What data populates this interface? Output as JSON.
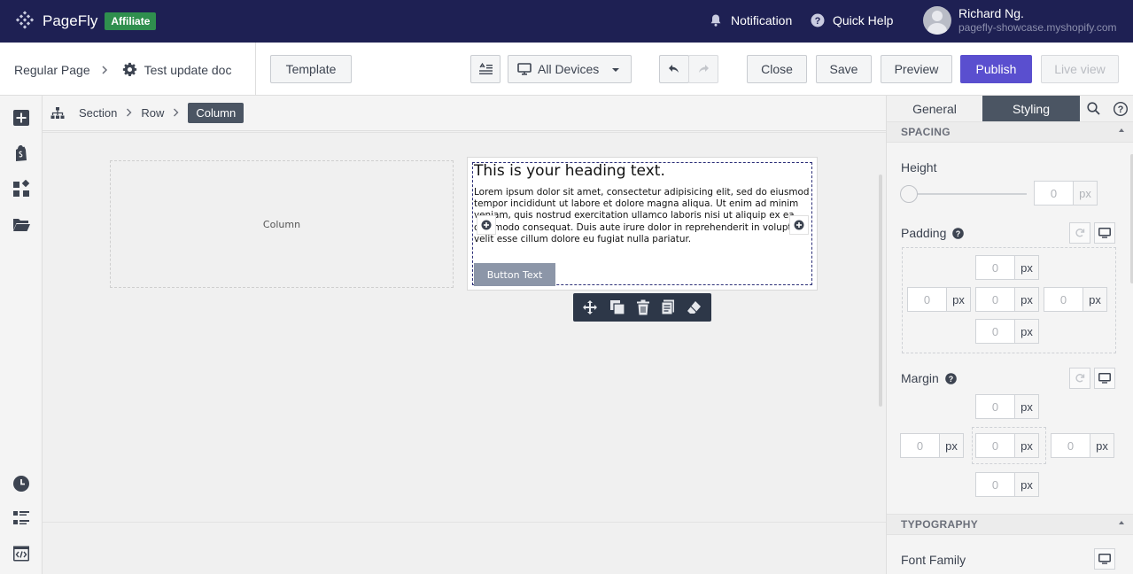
{
  "app": {
    "logo_name": "PageFly",
    "badge": "Affiliate",
    "notification_label": "Notification",
    "quick_help_label": "Quick Help",
    "user_name": "Richard Ng.",
    "user_shop": "pagefly-showcase.myshopify.com"
  },
  "toolbar": {
    "page_type": "Regular Page",
    "page_name": "Test update doc",
    "template_label": "Template",
    "device_label": "All Devices",
    "close_label": "Close",
    "save_label": "Save",
    "preview_label": "Preview",
    "publish_label": "Publish",
    "live_view_label": "Live view"
  },
  "breadcrumb": {
    "items": [
      "Section",
      "Row",
      "Column"
    ]
  },
  "canvas": {
    "column_placeholder": "Column",
    "heading": "This is your heading text.",
    "paragraph": "Lorem ipsum dolor sit amet, consectetur adipisicing elit, sed do eiusmod tempor incididunt ut labore et dolore magna aliqua. Ut enim ad minim veniam, quis nostrud exercitation ullamco laboris nisi ut aliquip ex ea commodo consequat. Duis aute irure dolor in reprehenderit in voluptate velit esse cillum dolore eu fugiat nulla pariatur.",
    "button_text": "Button Text"
  },
  "panel": {
    "tab_general": "General",
    "tab_styling": "Styling",
    "spacing_title": "SPACING",
    "height_label": "Height",
    "height_value": "0",
    "unit": "px",
    "padding_label": "Padding",
    "padding": {
      "top": "0",
      "left": "0",
      "center": "0",
      "right": "0",
      "bottom": "0"
    },
    "margin_label": "Margin",
    "margin": {
      "top": "0",
      "left": "0",
      "center": "0",
      "right": "0",
      "bottom": "0"
    },
    "typography_title": "TYPOGRAPHY",
    "font_family_label": "Font Family"
  },
  "colors": {
    "topbar": "#1e2053",
    "publish": "#5a4fcf",
    "affiliate": "#2f8f4e",
    "active_tab": "#4b5563"
  }
}
